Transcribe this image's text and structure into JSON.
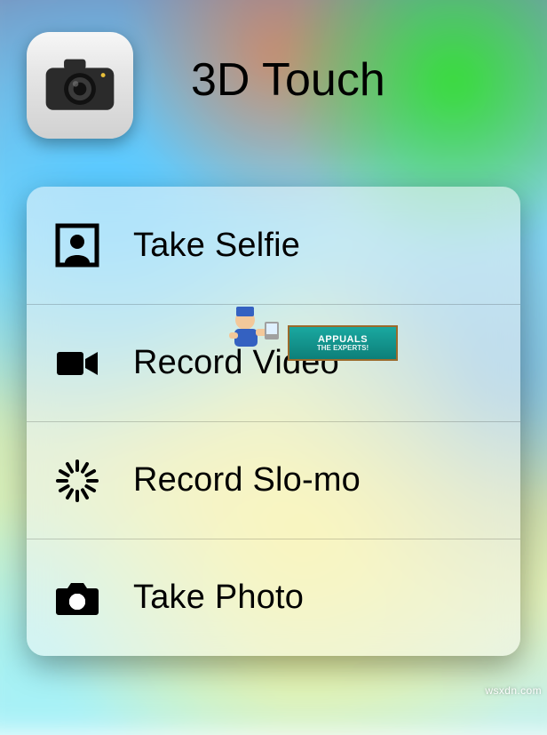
{
  "header": {
    "title": "3D Touch",
    "app_icon": "camera-app"
  },
  "quick_actions": [
    {
      "icon": "selfie-frame-icon",
      "label": "Take Selfie"
    },
    {
      "icon": "video-camera-icon",
      "label": "Record Video"
    },
    {
      "icon": "slomo-dial-icon",
      "label": "Record Slo-mo"
    },
    {
      "icon": "photo-camera-icon",
      "label": "Take Photo"
    }
  ],
  "watermark": {
    "brand_line1": "APPUALS",
    "brand_line2": "THE EXPERTS!"
  },
  "source_mark": "wsxdn.com"
}
